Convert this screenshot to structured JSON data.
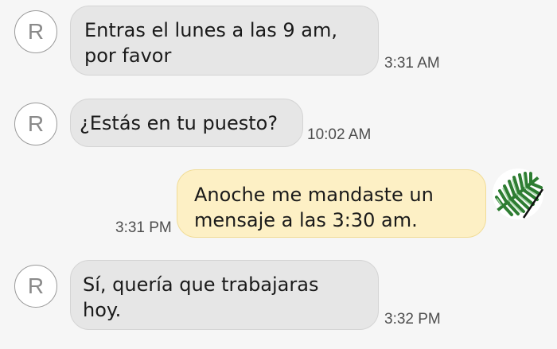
{
  "messages": [
    {
      "sender": "contact",
      "avatar_letter": "R",
      "text": "Entras el lunes a las 9 am,\npor favor",
      "time": "3:31 AM"
    },
    {
      "sender": "contact",
      "avatar_letter": "R",
      "text": "¿Estás en tu puesto?",
      "time": "10:02 AM"
    },
    {
      "sender": "me",
      "avatar_icon": "fern-leaf-icon",
      "text": "Anoche me mandaste un\nmensaje a las 3:30 am.",
      "time": "3:31 PM"
    },
    {
      "sender": "contact",
      "avatar_letter": "R",
      "text": "Sí, quería que trabajaras\nhoy.",
      "time": "3:32 PM"
    }
  ],
  "colors": {
    "background": "#f6f6f6",
    "incoming_bubble": "#e6e6e6",
    "outgoing_bubble": "#fdf0c5",
    "outgoing_border": "#f1dc97",
    "avatar_border": "#9a9a9a",
    "fern_green": "#2e7d32"
  }
}
